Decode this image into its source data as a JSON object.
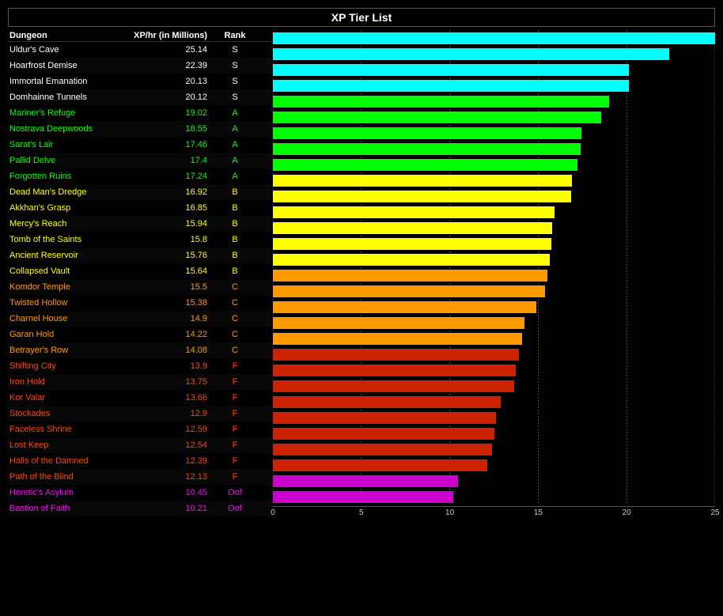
{
  "title": "XP Tier List",
  "headers": {
    "dungeon": "Dungeon",
    "xp": "XP/hr (in Millions)",
    "rank": "Rank"
  },
  "axis": {
    "min": 0,
    "max": 25,
    "ticks": [
      0,
      5,
      10,
      15,
      20,
      25
    ]
  },
  "dungeons": [
    {
      "name": "Uldur's Cave",
      "xp": 25.14,
      "rank": "S"
    },
    {
      "name": "Hoarfrost Demise",
      "xp": 22.39,
      "rank": "S"
    },
    {
      "name": "Immortal Emanation",
      "xp": 20.13,
      "rank": "S"
    },
    {
      "name": "Domhainne Tunnels",
      "xp": 20.12,
      "rank": "S"
    },
    {
      "name": "Mariner's Refuge",
      "xp": 19.02,
      "rank": "A"
    },
    {
      "name": "Nostrava Deepwoods",
      "xp": 18.55,
      "rank": "A"
    },
    {
      "name": "Sarat's Lair",
      "xp": 17.46,
      "rank": "A"
    },
    {
      "name": "Pallid Delve",
      "xp": 17.4,
      "rank": "A"
    },
    {
      "name": "Forgotten Ruins",
      "xp": 17.24,
      "rank": "A"
    },
    {
      "name": "Dead Man's Dredge",
      "xp": 16.92,
      "rank": "B"
    },
    {
      "name": "Akkhan's Grasp",
      "xp": 16.85,
      "rank": "B"
    },
    {
      "name": "Mercy's Reach",
      "xp": 15.94,
      "rank": "B"
    },
    {
      "name": "Tomb of the Saints",
      "xp": 15.8,
      "rank": "B"
    },
    {
      "name": "Ancient Reservoir",
      "xp": 15.76,
      "rank": "B"
    },
    {
      "name": "Collapsed Vault",
      "xp": 15.64,
      "rank": "B"
    },
    {
      "name": "Komdor Temple",
      "xp": 15.5,
      "rank": "C"
    },
    {
      "name": "Twisted Hollow",
      "xp": 15.38,
      "rank": "C"
    },
    {
      "name": "Charnel House",
      "xp": 14.9,
      "rank": "C"
    },
    {
      "name": "Garan Hold",
      "xp": 14.22,
      "rank": "C"
    },
    {
      "name": "Betrayer's Row",
      "xp": 14.08,
      "rank": "C"
    },
    {
      "name": "Shifting City",
      "xp": 13.9,
      "rank": "F"
    },
    {
      "name": "Iron Hold",
      "xp": 13.75,
      "rank": "F"
    },
    {
      "name": "Kor Valar",
      "xp": 13.66,
      "rank": "F"
    },
    {
      "name": "Stockades",
      "xp": 12.9,
      "rank": "F"
    },
    {
      "name": "Faceless Shrine",
      "xp": 12.59,
      "rank": "F"
    },
    {
      "name": "Lost Keep",
      "xp": 12.54,
      "rank": "F"
    },
    {
      "name": "Halls of the Damned",
      "xp": 12.39,
      "rank": "F"
    },
    {
      "name": "Path of the Blind",
      "xp": 12.13,
      "rank": "F"
    },
    {
      "name": "Heretic's Asylum",
      "xp": 10.45,
      "rank": "Oof"
    },
    {
      "name": "Bastion of Faith",
      "xp": 10.21,
      "rank": "Oof"
    }
  ],
  "rankColors": {
    "S": "#00ffff",
    "A": "#00ff00",
    "B": "#ffff00",
    "C": "#ff9900",
    "F": "#cc2200",
    "Oof": "#cc00cc"
  }
}
